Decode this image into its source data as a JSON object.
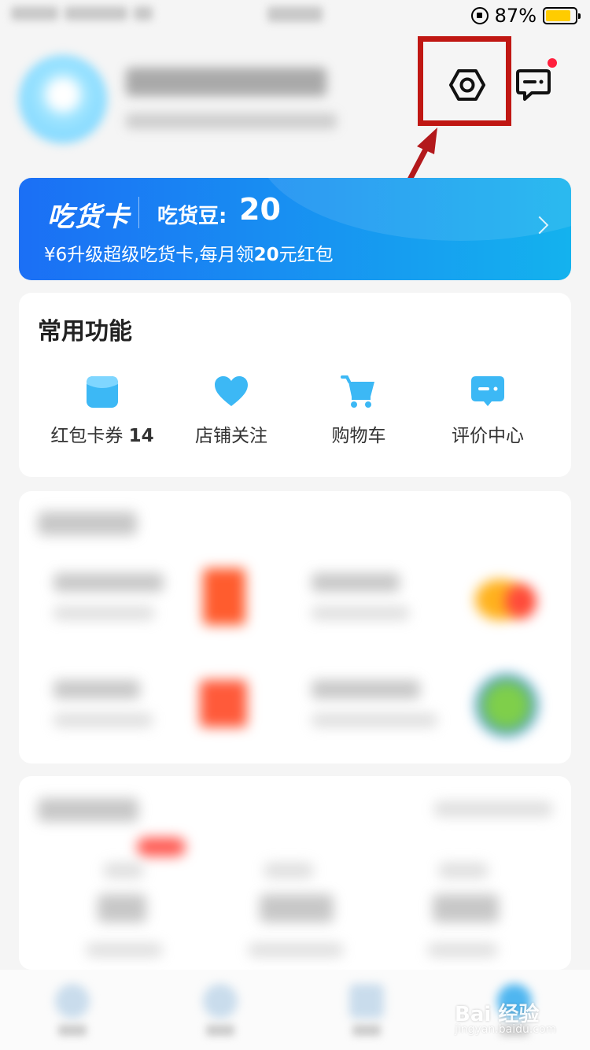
{
  "status_bar": {
    "battery_percent": "87%",
    "battery_level": 0.87,
    "battery_color": "#ffcc00"
  },
  "header": {
    "settings_icon": "settings-hexagon-icon",
    "message_icon": "message-icon",
    "message_dot_color": "#ff1f3d",
    "highlight_color": "#c01713"
  },
  "foodie_card": {
    "title": "吃货卡",
    "beans_label": "吃货豆:",
    "beans_value": "20",
    "promo_prefix": "¥6升级超级吃货卡,每月领",
    "promo_amount": "20",
    "promo_suffix": "元红包",
    "gradient_start": "#1b6ff5",
    "gradient_end": "#14b2ee"
  },
  "common_functions": {
    "title": "常用功能",
    "items": [
      {
        "label": "红包卡券",
        "count": "14",
        "icon": "coupon-icon"
      },
      {
        "label": "店铺关注",
        "icon": "heart-icon"
      },
      {
        "label": "购物车",
        "icon": "cart-icon"
      },
      {
        "label": "评价中心",
        "icon": "review-icon"
      }
    ],
    "icon_color": "#3cb8f5"
  },
  "watermark": {
    "brand": "Bai 经验",
    "url": "jingyan.baidu.com"
  }
}
